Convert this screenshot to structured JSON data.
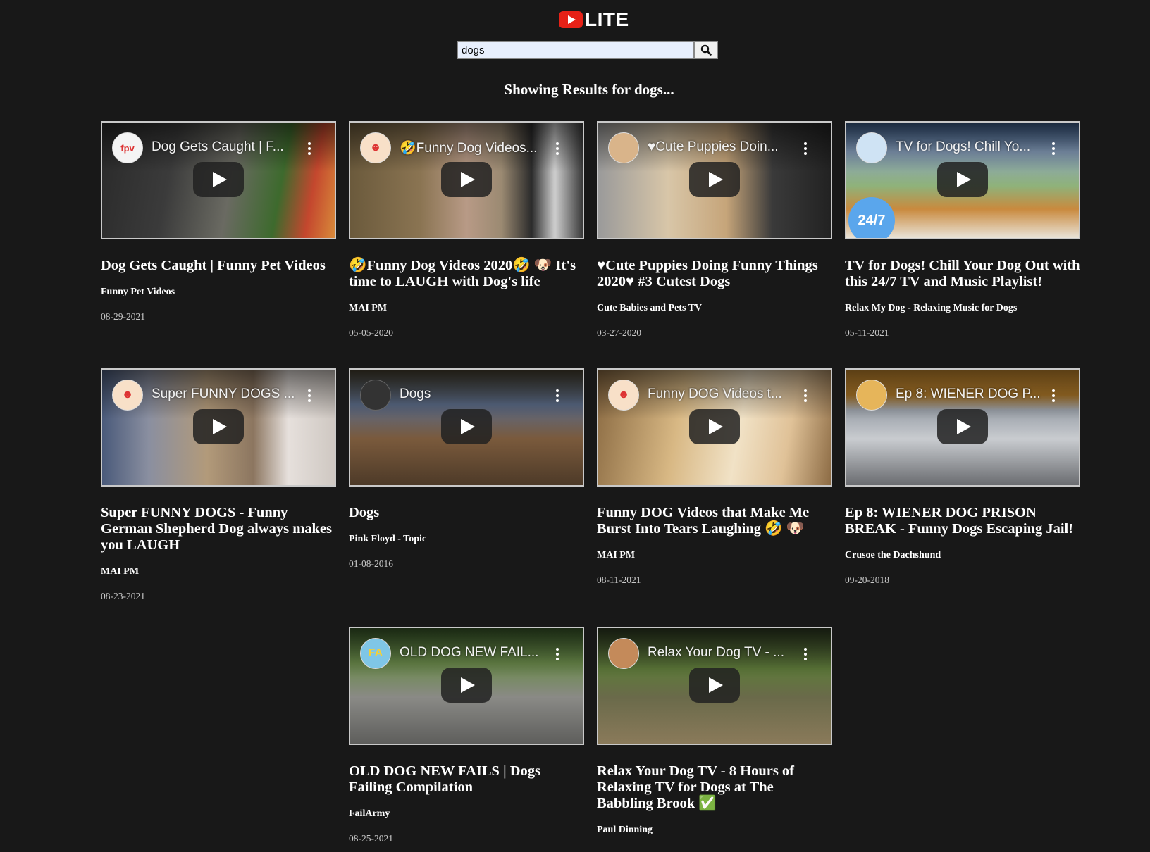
{
  "logo": {
    "text": "LITE"
  },
  "search": {
    "value": "dogs"
  },
  "heading": "Showing Results for dogs...",
  "videos": [
    {
      "overlay_title": "Dog Gets Caught | F...",
      "title": "Dog Gets Caught | Funny Pet Videos",
      "channel": "Funny Pet Videos",
      "date": "08-29-2021",
      "avatar": "fpv"
    },
    {
      "overlay_title": "🤣Funny Dog Videos...",
      "title": "🤣Funny Dog Videos 2020🤣 🐶 It's time to LAUGH with Dog's life",
      "channel": "MAI PM",
      "date": "05-05-2020",
      "avatar": ""
    },
    {
      "overlay_title": "♥Cute Puppies Doin...",
      "title": "♥Cute Puppies Doing Funny Things 2020♥ #3 Cutest Dogs",
      "channel": "Cute Babies and Pets TV",
      "date": "03-27-2020",
      "avatar": ""
    },
    {
      "overlay_title": "TV for Dogs! Chill Yo...",
      "title": "TV for Dogs! Chill Your Dog Out with this 24/7 TV and Music Playlist!",
      "channel": "Relax My Dog - Relaxing Music for Dogs",
      "date": "05-11-2021",
      "avatar": "",
      "badge": "24/7"
    },
    {
      "overlay_title": "Super FUNNY DOGS ...",
      "title": "Super FUNNY DOGS - Funny German Shepherd Dog always makes you LAUGH",
      "channel": "MAI PM",
      "date": "08-23-2021",
      "avatar": ""
    },
    {
      "overlay_title": "Dogs",
      "title": "Dogs",
      "channel": "Pink Floyd - Topic",
      "date": "01-08-2016",
      "avatar": ""
    },
    {
      "overlay_title": "Funny DOG Videos t...",
      "title": "Funny DOG Videos that Make Me Burst Into Tears Laughing 🤣 🐶",
      "channel": "MAI PM",
      "date": "08-11-2021",
      "avatar": ""
    },
    {
      "overlay_title": "Ep 8: WIENER DOG P...",
      "title": "Ep 8: WIENER DOG PRISON BREAK - Funny Dogs Escaping Jail!",
      "channel": "Crusoe the Dachshund",
      "date": "09-20-2018",
      "avatar": ""
    },
    {
      "overlay_title": "OLD DOG NEW FAIL...",
      "title": "OLD DOG NEW FAILS | Dogs Failing Compilation",
      "channel": "FailArmy",
      "date": "08-25-2021",
      "avatar": "FA"
    },
    {
      "overlay_title": "Relax Your Dog TV - ...",
      "title": "Relax Your Dog TV - 8 Hours of Relaxing TV for Dogs at The Babbling Brook ✅",
      "channel": "Paul Dinning",
      "date": "",
      "avatar": ""
    }
  ],
  "colors": {
    "background": "#181818",
    "logo_red": "#e62117",
    "search_bg": "#e8effd"
  }
}
